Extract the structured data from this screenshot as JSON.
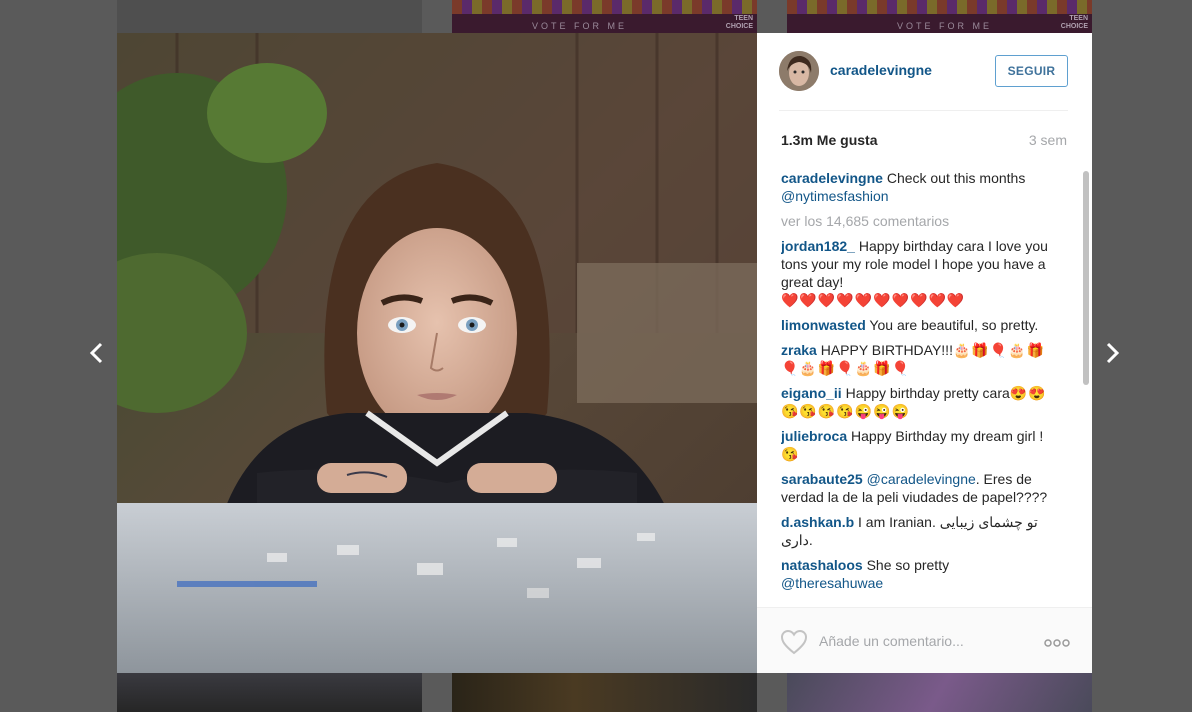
{
  "background": {
    "tile_b_text": "VOTE FOR ME",
    "tile_c_text": "VOTE FOR ME",
    "tile_brand_line1": "TEEN",
    "tile_brand_line2": "CHOICE"
  },
  "post": {
    "username": "caradelevingne",
    "follow_label": "SEGUIR",
    "likes": "1.3m Me gusta",
    "time": "3 sem",
    "caption_user": "caradelevingne",
    "caption_text": " Check out this months ",
    "caption_mention": "@nytimesfashion",
    "view_all": "ver los 14,685 comentarios"
  },
  "comments": [
    {
      "user": "jordan182_",
      "text": " Happy birthday cara I love you tons your my role model I hope you have a great day!",
      "emoji": "❤️❤️❤️❤️❤️❤️❤️❤️❤️❤️"
    },
    {
      "user": "limonwasted",
      "text": " You are beautiful, so pretty."
    },
    {
      "user": "zraka",
      "text": " HAPPY BIRTHDAY!!!",
      "emoji": "🎂🎁🎈🎂🎁🎈🎂🎁🎈🎂🎁🎈"
    },
    {
      "user": "eigano_ii",
      "text": " Happy birthday pretty cara",
      "emoji": "😍😍😘😘😘😘😜😜😜"
    },
    {
      "user": "juliebroca",
      "text": " Happy Birthday my dream girl ! ",
      "emoji": "😘"
    },
    {
      "user": "sarabaute25",
      "mention": " @caradelevingne",
      "text": ". Eres de verdad la de la peli viudades de papel????"
    },
    {
      "user": "d.ashkan.b",
      "text": " I am Iranian. تو چشمای زیبایی داری."
    },
    {
      "user": "natashaloos",
      "text": " She so pretty ",
      "mention2": "@theresahuwae"
    }
  ],
  "footer": {
    "placeholder": "Añade un comentario..."
  },
  "icons": {
    "prev": "chevron-left-icon",
    "next": "chevron-right-icon",
    "like": "heart-icon",
    "options": "more-dots-icon"
  },
  "colors": {
    "link": "#125688",
    "muted": "#a5a7aa",
    "follow_border": "#5fa0d0",
    "overlay": "#5a5a5a"
  }
}
